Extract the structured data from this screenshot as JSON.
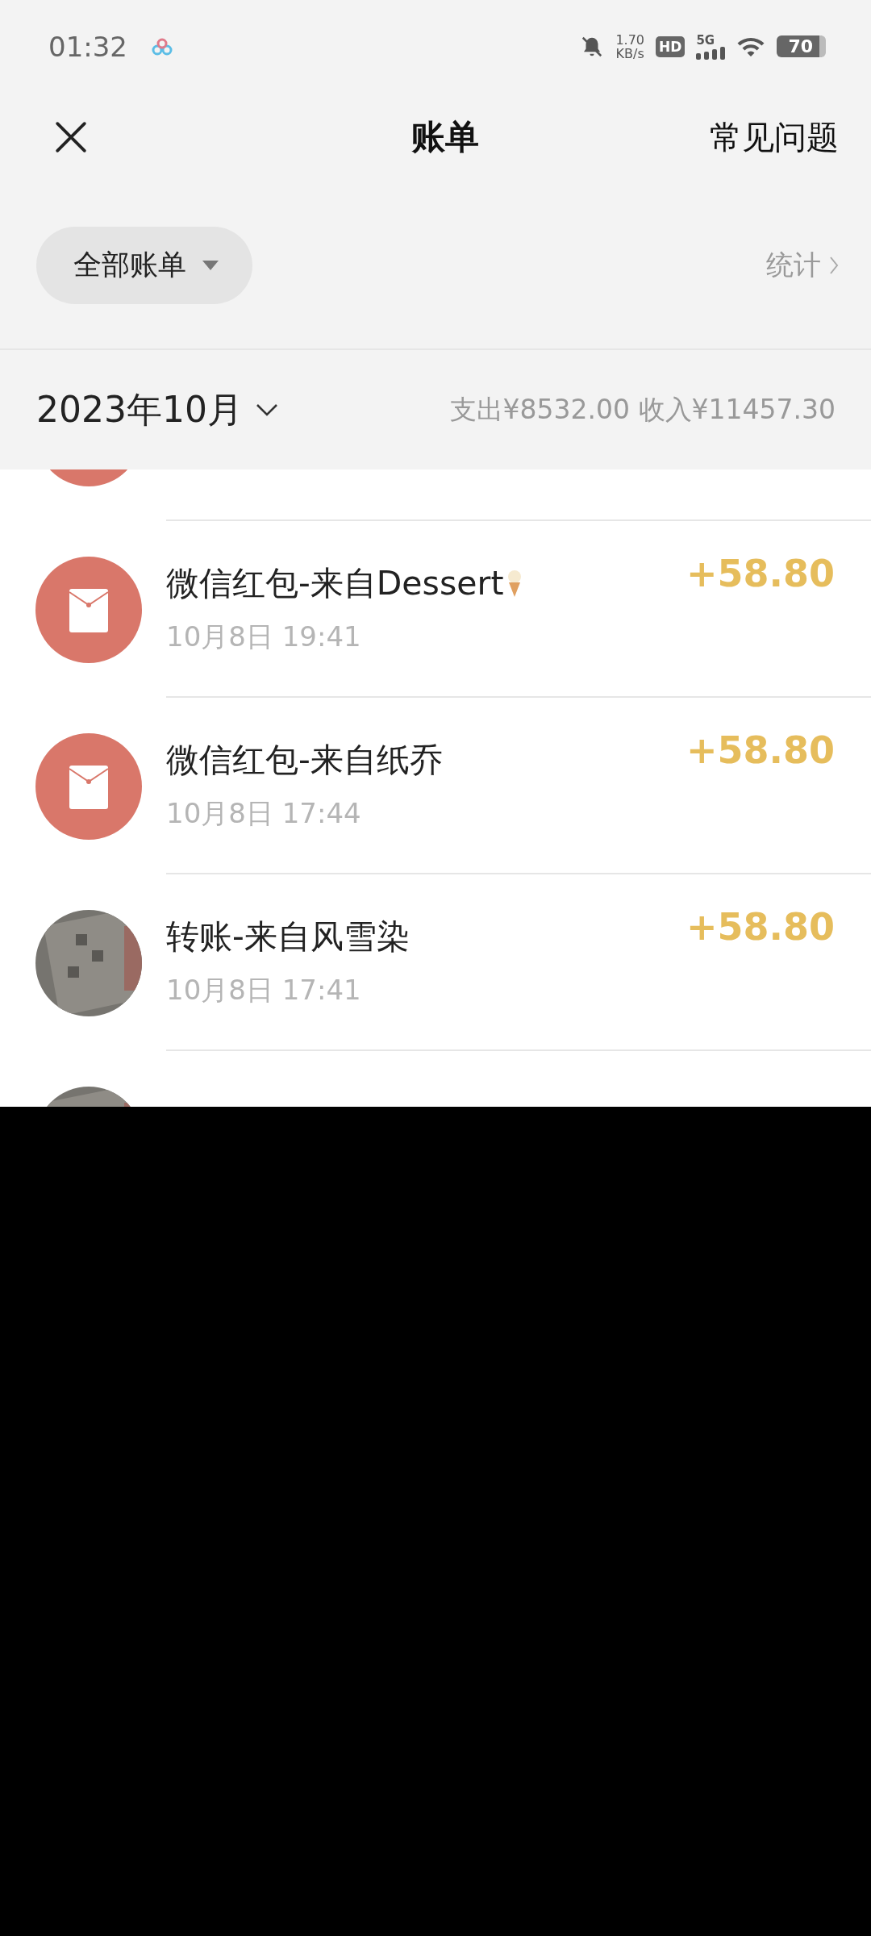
{
  "status_bar": {
    "time": "01:32",
    "net_speed": "1.70",
    "net_unit": "KB/s",
    "hd": "HD",
    "network": "5G",
    "battery": "70"
  },
  "header": {
    "title": "账单",
    "faq": "常见问题"
  },
  "filter": {
    "label": "全部账单",
    "stats": "统计"
  },
  "month": {
    "label": "2023年10月",
    "summary": "支出¥8532.00 收入¥11457.30"
  },
  "transactions": [
    {
      "kind": "red_packet"
    },
    {
      "kind": "red_packet",
      "title": "微信红包-来自Dessert",
      "emoji_icon": true,
      "time": "10月8日 19:41",
      "amount": "+58.80"
    },
    {
      "kind": "red_packet",
      "title": "微信红包-来自纸乔",
      "time": "10月8日 17:44",
      "amount": "+58.80"
    },
    {
      "kind": "transfer",
      "title": "转账-来自风雪染",
      "time": "10月8日 17:41",
      "amount": "+58.80"
    },
    {
      "kind": "transfer"
    }
  ]
}
